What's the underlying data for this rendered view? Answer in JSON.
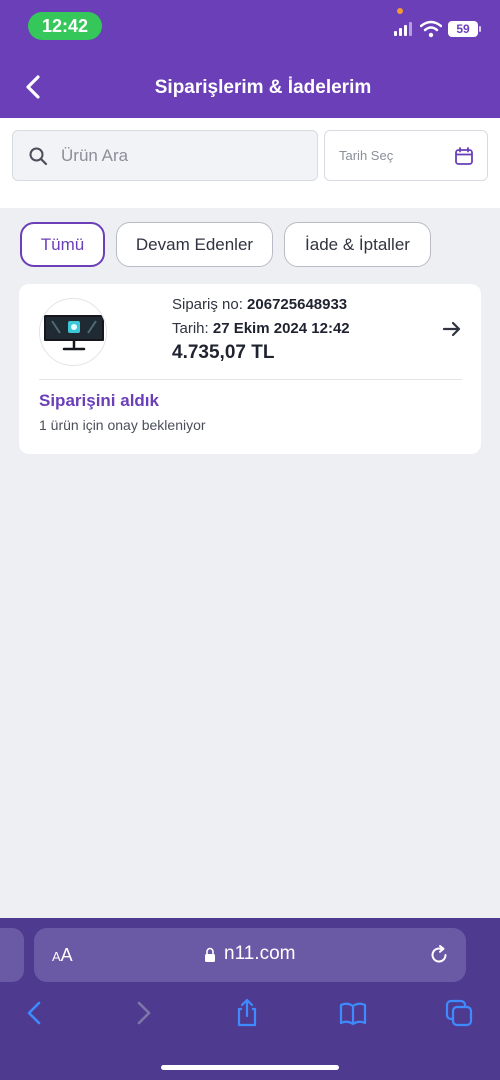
{
  "status_bar": {
    "time": "12:42",
    "battery": "59"
  },
  "header": {
    "title": "Siparişlerim & İadelerim"
  },
  "search": {
    "placeholder": "Ürün Ara"
  },
  "date_filter": {
    "label": "Tarih Seç"
  },
  "tabs": [
    {
      "label": "Tümü",
      "active": true
    },
    {
      "label": "Devam Edenler",
      "active": false
    },
    {
      "label": "İade & İptaller",
      "active": false
    }
  ],
  "order": {
    "order_no_label": "Sipariş no:",
    "order_no": "206725648933",
    "date_label": "Tarih:",
    "date": "27 Ekim 2024 12:42",
    "price": "4.735,07 TL",
    "status_title": "Siparişini aldık",
    "status_sub": "1 ürün için onay bekleniyor"
  },
  "browser": {
    "aa_small": "A",
    "aa_large": "A",
    "url": "n11.com"
  },
  "colors": {
    "brand": "#6a3fb8",
    "safari_bar": "#4e3b8f",
    "page_bg": "#eeeff3"
  }
}
